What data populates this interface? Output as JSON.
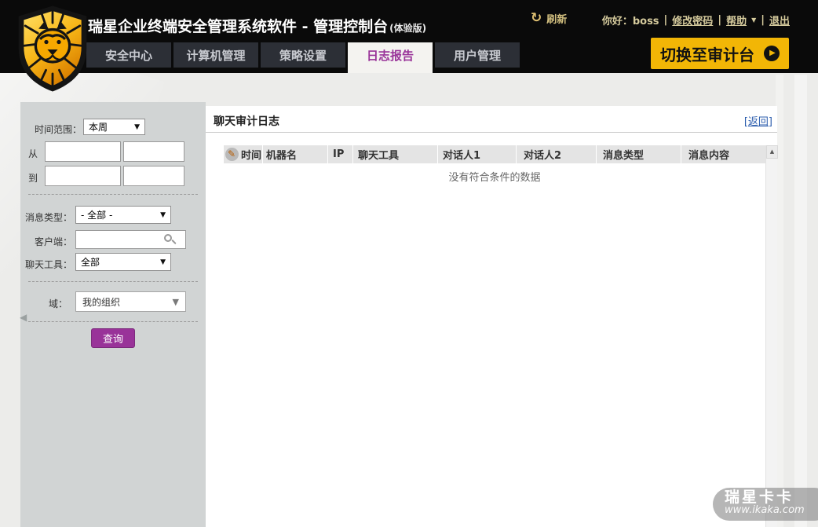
{
  "header": {
    "title": "瑞星企业终端安全管理系统软件 - 管理控制台",
    "title_suffix": "(体验版)",
    "refresh_label": "刷新",
    "user": {
      "greeting": "你好：boss",
      "separator": "|",
      "change_password": "修改密码",
      "help": "帮助",
      "logout": "退出"
    },
    "switch_button_label": "切换至审计台",
    "tabs": [
      {
        "label": "安全中心",
        "active": false
      },
      {
        "label": "计算机管理",
        "active": false
      },
      {
        "label": "策略设置",
        "active": false
      },
      {
        "label": "日志报告",
        "active": true
      },
      {
        "label": "用户管理",
        "active": false
      }
    ]
  },
  "sidebar": {
    "time_range_label": "时间范围：",
    "time_range_value": "本周",
    "from_label": "从",
    "to_label": "到",
    "message_type_label": "消息类型：",
    "message_type_value": "- 全部 -",
    "client_label": "客户端：",
    "chat_tool_label": "聊天工具：",
    "chat_tool_value": "全部",
    "domain_label": "域：",
    "domain_value": "我的组织",
    "query_button_label": "查询"
  },
  "main": {
    "title": "聊天审计日志",
    "back_link": "[返回]",
    "table": {
      "columns": [
        "时间",
        "机器名",
        "IP",
        "聊天工具",
        "对话人1",
        "对话人2",
        "消息类型",
        "消息内容"
      ],
      "empty_message": "没有符合条件的数据"
    }
  },
  "watermark": {
    "brand": "瑞星卡卡",
    "url": "www.ikaka.com"
  },
  "icons": {
    "refresh": "↻",
    "dropdown_caret": "▼",
    "help_caret": "▼",
    "play": "▶",
    "scroll_up": "▲",
    "collapse": "◀",
    "pencil": "✎"
  },
  "colors": {
    "accent_purple": "#993399",
    "brand_yellow": "#f2b606",
    "link_blue": "#2b5cad",
    "header_black": "#0a0a0a",
    "sidebar_gray": "#d1d4d4"
  }
}
